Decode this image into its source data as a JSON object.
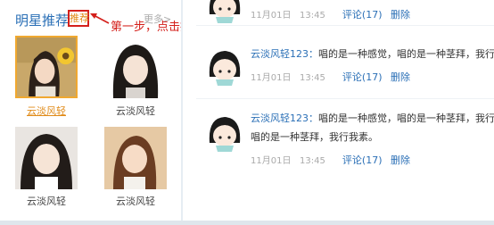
{
  "left_panel": {
    "title": "明星推荐",
    "recommend_label": "推荐",
    "more_label": "更多>",
    "annotation": "第一步，点击推荐",
    "stars": [
      {
        "name": "云淡风轻",
        "selected": true
      },
      {
        "name": "云淡风轻",
        "selected": false
      },
      {
        "name": "云淡风轻",
        "selected": false
      },
      {
        "name": "云淡风轻",
        "selected": false
      }
    ]
  },
  "feed": {
    "comments": [
      {
        "user": "",
        "text": "",
        "text_line2": "",
        "date": "11月01日",
        "time": "13:45",
        "comment_label": "评论(17)",
        "delete_label": "删除"
      },
      {
        "user": "云淡风轻123：",
        "text": "唱的是一种感觉，唱的是一种茎拜，我行我素",
        "text_line2": "",
        "date": "11月01日",
        "time": "13:45",
        "comment_label": "评论(17)",
        "delete_label": "删除"
      },
      {
        "user": "云淡风轻123：",
        "text": "唱的是一种感觉，唱的是一种茎拜，我行我素",
        "text_line2": "唱的是一种茎拜，我行我素。",
        "date": "11月01日",
        "time": "13:45",
        "comment_label": "评论(17)",
        "delete_label": "删除"
      }
    ]
  },
  "colors": {
    "link_blue": "#2a6fb6",
    "highlight_orange": "#e08a17",
    "annotation_red": "#d4201b",
    "muted_gray": "#aaaaaa"
  }
}
